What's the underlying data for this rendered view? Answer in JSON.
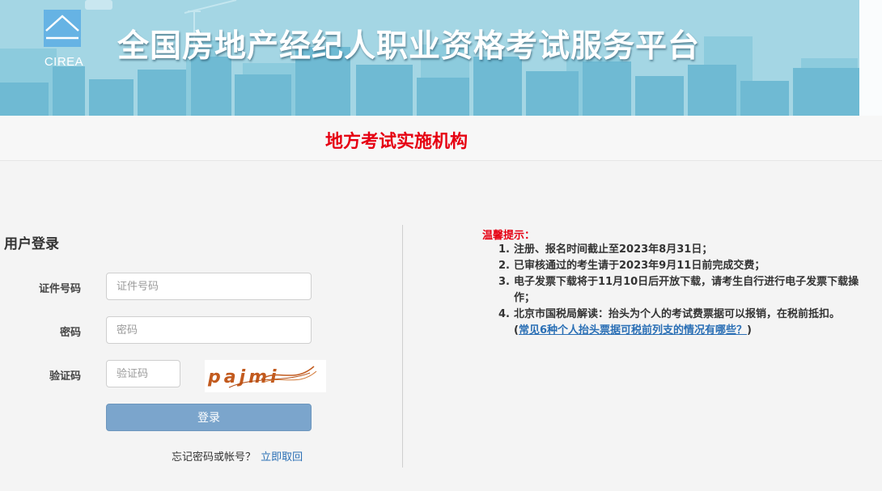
{
  "header": {
    "logo_text": "CIREA",
    "site_title": "全国房地产经纪人职业资格考试服务平台"
  },
  "org": {
    "title": "地方考试实施机构"
  },
  "login": {
    "title": "用户登录",
    "id_label": "证件号码",
    "id_placeholder": "证件号码",
    "password_label": "密码",
    "password_placeholder": "密码",
    "captcha_label": "验证码",
    "captcha_placeholder": "验证码",
    "captcha_text": "pajmi",
    "submit_label": "登录",
    "forgot_text": "忘记密码或帐号？",
    "forgot_link": "立即取回"
  },
  "notice": {
    "title": "温馨提示：",
    "items": [
      {
        "num": "1.",
        "text": "注册、报名时间截止至2023年8月31日；"
      },
      {
        "num": "2.",
        "text": "已审核通过的考生请于2023年9月11日前完成交费；"
      },
      {
        "num": "3.",
        "text": "电子发票下载将于11月10日后开放下载，请考生自行进行电子发票下载操作；"
      },
      {
        "num": "4.",
        "text": "北京市国税局解读：抬头为个人的考试费票据可以报销，在税前抵扣。",
        "paren_open": "(",
        "link": "常见6种个人抬头票据可税前列支的情况有哪些？",
        "paren_close": ")"
      }
    ]
  },
  "colors": {
    "banner_sky": "#9fd3e2",
    "banner_city": "#6db9d2",
    "org_title": "#e60012",
    "button": "#7ba5cc",
    "link": "#2a6fb5"
  }
}
